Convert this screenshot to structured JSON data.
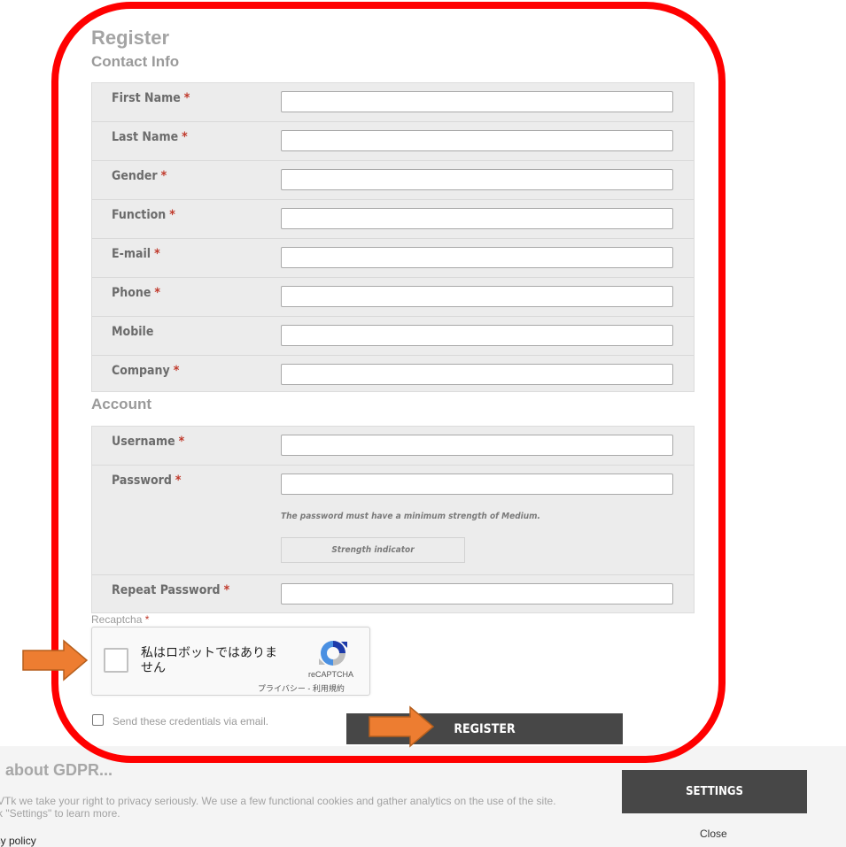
{
  "page": {
    "title": "Register",
    "contact_section": "Contact Info",
    "account_section": "Account"
  },
  "contact_fields": [
    {
      "label": "First Name",
      "required": "*"
    },
    {
      "label": "Last Name",
      "required": "*"
    },
    {
      "label": "Gender",
      "required": "*"
    },
    {
      "label": "Function",
      "required": "*"
    },
    {
      "label": "E-mail",
      "required": "*"
    },
    {
      "label": "Phone",
      "required": "*"
    },
    {
      "label": "Mobile",
      "required": ""
    },
    {
      "label": "Company",
      "required": "*"
    }
  ],
  "account_fields": {
    "username": {
      "label": "Username",
      "required": "*"
    },
    "password": {
      "label": "Password",
      "required": "*",
      "note": "The password must have a minimum strength of Medium.",
      "strength_indicator": "Strength indicator"
    },
    "repeat_password": {
      "label": "Repeat Password",
      "required": "*"
    }
  },
  "recaptcha": {
    "label": "Recaptcha",
    "required": "*",
    "checkbox_text": "私はロボットではありません",
    "brand": "reCAPTCHA",
    "links": "プライバシー - 利用規約"
  },
  "send_credentials": {
    "label": "Send these credentials via email."
  },
  "register_button": {
    "label": "REGISTER"
  },
  "gdpr": {
    "title": "word about GDPR...",
    "text_line1": "VTk we take your right to privacy seriously. We use a few functional cookies and gather analytics on the use of the site.",
    "text_line2": "k \"Settings\" to learn more.",
    "privacy_link": "acy policy",
    "settings_button": "SETTINGS",
    "close_link": "Close"
  },
  "colors": {
    "highlight": "#ff0000",
    "arrow": "#ed7d31",
    "button_bg": "#474747",
    "required": "#c0392b"
  },
  "icons": [
    "recaptcha-logo-icon",
    "orange-arrow-icon"
  ]
}
